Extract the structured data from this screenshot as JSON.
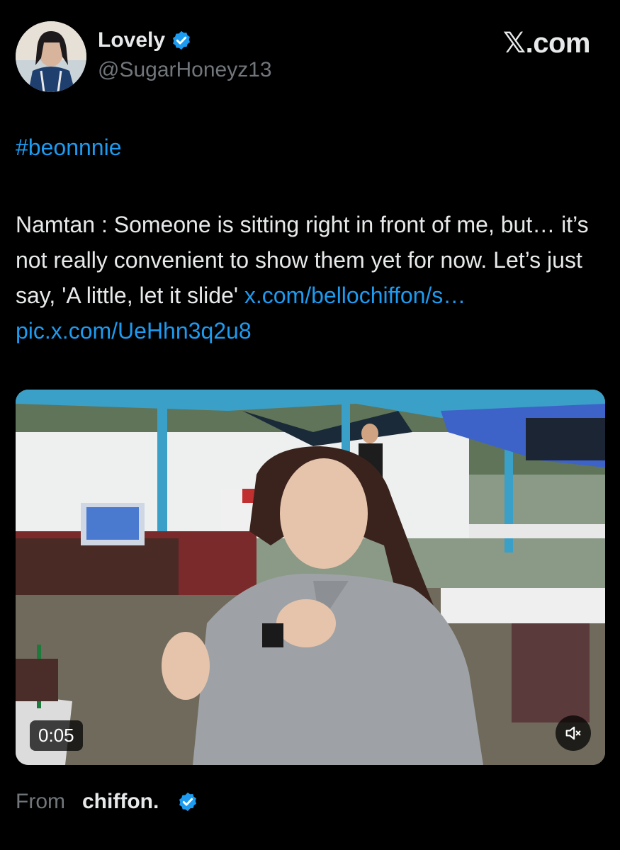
{
  "author": {
    "display_name": "Lovely",
    "handle": "@SugarHoneyz13",
    "verified": true
  },
  "brand": {
    "logo_text": "𝕏.com"
  },
  "tweet": {
    "hashtag": "#beonnnie",
    "body_text": "Namtan : Someone is sitting right in front of me, but… it’s not really convenient to show them yet for now. Let’s just say, 'A little, let it slide' ",
    "link_1": "x.com/bellochiffon/s…",
    "link_2": "pic.x.com/UeHhn3q2u8"
  },
  "media": {
    "type": "video",
    "duration": "0:05",
    "muted": true
  },
  "source": {
    "from_label": "From",
    "account_name": "chiffon.",
    "verified": true
  },
  "colors": {
    "background": "#000000",
    "link": "#1d9bf0",
    "verified_badge": "#1d9bf0",
    "secondary_text": "#71767b"
  },
  "icons": {
    "verified": "verified-badge-icon",
    "mute": "speaker-muted-icon"
  }
}
